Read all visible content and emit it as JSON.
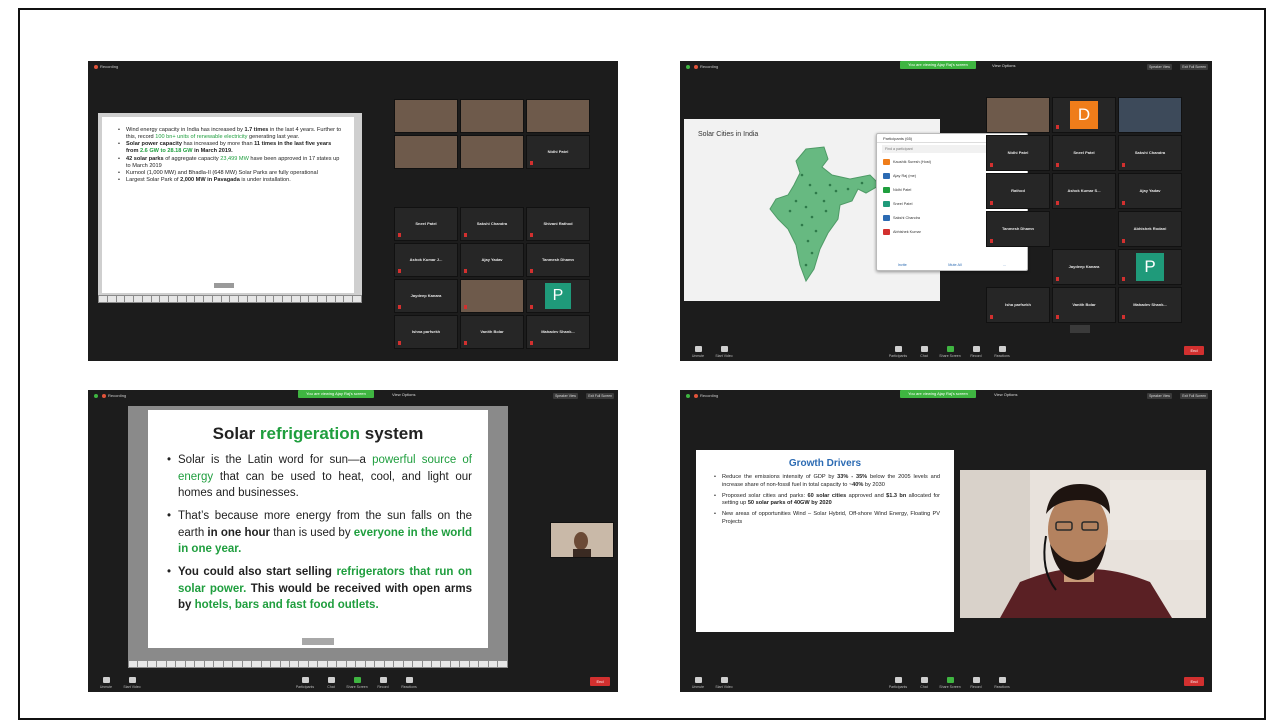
{
  "shot1": {
    "slide_bullets": [
      {
        "parts": [
          [
            "",
            "Wind energy capacity in India has increased by "
          ],
          [
            "b",
            "1.7 times"
          ],
          [
            "",
            " in the last 4 years. Further to this, record "
          ],
          [
            "g",
            "100 bn+ units of renewable electricity"
          ],
          [
            "",
            " generating last year."
          ]
        ]
      },
      {
        "parts": [
          [
            "b",
            "Solar power capacity"
          ],
          [
            "",
            " has increased by more than "
          ],
          [
            "b",
            "11 times in the last five years from "
          ],
          [
            "gb",
            "2.6 GW to 28.18 GW"
          ],
          [
            "b",
            " in March 2019."
          ]
        ]
      },
      {
        "parts": [
          [
            "b",
            "42 solar parks"
          ],
          [
            "",
            " of aggregate capacity "
          ],
          [
            "g",
            "23,499 MW"
          ],
          [
            "",
            " have been approved in 17 states up to March 2019"
          ]
        ]
      },
      {
        "parts": [
          [
            "",
            "Kurnool (1,000 MW) and Bhadla-II (648 MW) Solar Parks are fully operational"
          ]
        ]
      },
      {
        "parts": [
          [
            "",
            "Largest Solar Park of "
          ],
          [
            "b",
            "2,000 MW in Pavagada"
          ],
          [
            "",
            " is under installation."
          ]
        ]
      }
    ],
    "tiles": [
      "Nidhi Patel",
      "Sneel Patel",
      "Sakshi Chandra",
      "Shivani Rathod",
      "Ashok Kumar J...",
      "Ajay Yadav",
      "Tanmesh Dhamn",
      "Jaydeep Kanara",
      "",
      "P",
      "Ishna parfsekh",
      "Vanith Bolar",
      "Mahadev Shank..."
    ]
  },
  "shot2": {
    "slide_title": "Solar Cities in India",
    "popup_title": "Participants (65)",
    "popup_search": "Find a participant",
    "participants": [
      "Kaushik Suresh (Host)",
      "Ajay Raj (me)",
      "Nidhi Patel",
      "Sneel Patel",
      "Sakshi Chandra",
      "Abhishek Kumar"
    ],
    "popup_buttons": [
      "Invite",
      "Mute All",
      "..."
    ],
    "tiles": [
      "D",
      "Nidhi Patel",
      "Sneel Patel",
      "Sakshi Chandra",
      "Rathod",
      "Ashok Kumar S...",
      "Ajay Yadav",
      "Tanmesh Dhamn",
      "Jaydeep Kanara",
      "P",
      "Isha parfsekh",
      "Vanith Bolar",
      "Mahadev Shank...",
      "Abhishek Rodani"
    ]
  },
  "shot3": {
    "title_parts": [
      [
        "",
        "Solar "
      ],
      [
        "g",
        "refrigeration"
      ],
      [
        "",
        " system"
      ]
    ],
    "bullets": [
      {
        "parts": [
          [
            "",
            "Solar is the Latin word for sun—a "
          ],
          [
            "g",
            "powerful source of energy"
          ],
          [
            "",
            " that can be used to heat, cool, and light our homes and businesses."
          ]
        ]
      },
      {
        "parts": [
          [
            "",
            "That’s because more energy from the sun falls on the earth "
          ],
          [
            "b",
            "in one hour"
          ],
          [
            "",
            " than is used by "
          ],
          [
            "gb",
            "everyone in the world in one year."
          ]
        ]
      },
      {
        "parts": [
          [
            "b",
            "You could also start selling "
          ],
          [
            "gb",
            "refrigerators that run on solar power."
          ],
          [
            "b",
            " This would be received with open arms by "
          ],
          [
            "gb",
            "hotels, bars and fast food outlets."
          ]
        ]
      }
    ]
  },
  "shot4": {
    "title": "Growth Drivers",
    "bullets": [
      {
        "parts": [
          [
            "",
            "Reduce the emissions intensity of GDP by "
          ],
          [
            "b",
            "33% - 35%"
          ],
          [
            "",
            " below the 2005 levels and increase share of non-fossil fuel in total capacity to ~"
          ],
          [
            "b",
            "40%"
          ],
          [
            "",
            " by 2030"
          ]
        ]
      },
      {
        "parts": [
          [
            "",
            "Proposed solar cities and parks: "
          ],
          [
            "b",
            "60 solar cities"
          ],
          [
            "",
            " approved and "
          ],
          [
            "b",
            "$1.3 bn"
          ],
          [
            "",
            " allocated for setting up "
          ],
          [
            "b",
            "50 solar parks of 40GW by 2020"
          ]
        ]
      },
      {
        "parts": [
          [
            "",
            "New areas of opportunities Wind – Solar Hybrid, Off-shore Wind Energy, Floating PV Projects"
          ]
        ]
      }
    ]
  },
  "toolbar": {
    "left": [
      "Unmute",
      "Start Video"
    ],
    "center": [
      "Participants",
      "Chat",
      "Share Screen",
      "Record",
      "Reactions"
    ],
    "end": "End"
  },
  "topbar": {
    "recording": "Recording",
    "sharing": "You are viewing Ajay Raj's screen",
    "view_options": "View Options",
    "speaker_view": "Speaker View",
    "exit_full": "Exit Full Screen"
  },
  "colors": {
    "zoom_bg": "#1c1c1c",
    "accent_green": "#3fb541",
    "end_red": "#d2302f",
    "slide_green": "#1f9e3e",
    "slide_blue": "#2c6bb3"
  }
}
